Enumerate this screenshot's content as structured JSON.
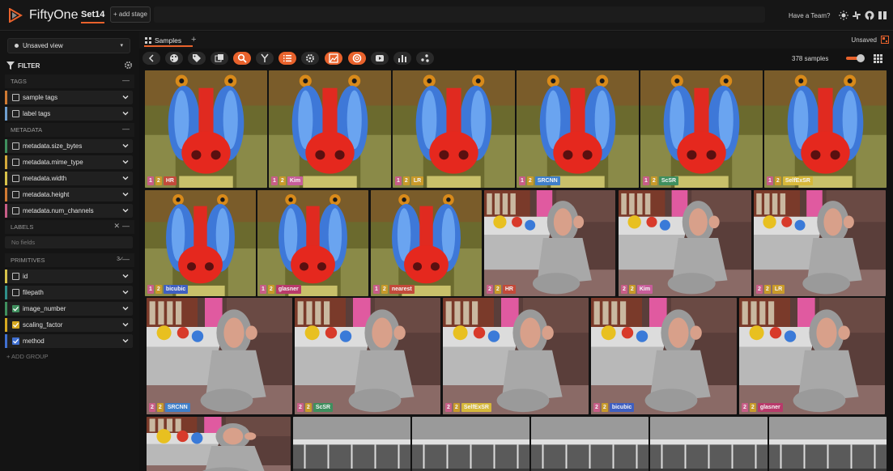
{
  "app": {
    "brand": "FiftyOne",
    "dataset": "Set14",
    "add_stage": "+ add stage",
    "team": "Have a Team?",
    "accent": "#e8622c"
  },
  "sidebar": {
    "view": "Unsaved view",
    "filter_label": "FILTER",
    "sections": {
      "tags": "TAGS",
      "metadata": "METADATA",
      "labels": "LABELS",
      "primitives": "PRIMITIVES",
      "primitives_count": "3"
    },
    "tag_fields": [
      "sample tags",
      "label tags"
    ],
    "metadata_fields": [
      "metadata.size_bytes",
      "metadata.mime_type",
      "metadata.width",
      "metadata.height",
      "metadata.num_channels"
    ],
    "labels_empty": "No fields",
    "primitive_fields": [
      "id",
      "filepath",
      "image_number",
      "scaling_factor",
      "method"
    ],
    "add_group": "+ ADD GROUP",
    "field_colors": [
      "#d07a32",
      "#6e9fd0",
      "#3f8f5e",
      "#d3a83a",
      "#d6c24a",
      "#d07a32",
      "#c75d87",
      "#d6c24a",
      "#2f8f8a",
      "#3f8f5e",
      "#d6a820",
      "#3f6fd0"
    ]
  },
  "tabs": {
    "samples": "Samples",
    "add": "+",
    "unsaved": "Unsaved"
  },
  "toolbar": {
    "count": "378 samples",
    "icons": [
      "chevron-left-icon",
      "palette-icon",
      "tag-icon",
      "clone-icon",
      "search-icon",
      "merge-icon",
      "list-icon",
      "gear-icon",
      "image-icon",
      "openai-icon",
      "video-icon",
      "chart-icon",
      "cluster-icon"
    ]
  },
  "grid": {
    "row1": [
      {
        "n": "1",
        "s": "2",
        "method": "HR"
      },
      {
        "n": "1",
        "s": "2",
        "method": "Kim"
      },
      {
        "n": "1",
        "s": "2",
        "method": "LR"
      },
      {
        "n": "1",
        "s": "2",
        "method": "SRCNN"
      },
      {
        "n": "1",
        "s": "2",
        "method": "ScSR"
      },
      {
        "n": "1",
        "s": "2",
        "method": "SelfExSR"
      }
    ],
    "row2": [
      {
        "n": "1",
        "s": "2",
        "method": "bicubic"
      },
      {
        "n": "1",
        "s": "2",
        "method": "glasner"
      },
      {
        "n": "1",
        "s": "2",
        "method": "nearest"
      },
      {
        "n": "2",
        "s": "2",
        "method": "HR"
      },
      {
        "n": "2",
        "s": "2",
        "method": "Kim"
      },
      {
        "n": "2",
        "s": "2",
        "method": "LR"
      }
    ],
    "row3": [
      {
        "n": "2",
        "s": "2",
        "method": "SRCNN"
      },
      {
        "n": "2",
        "s": "2",
        "method": "ScSR"
      },
      {
        "n": "2",
        "s": "2",
        "method": "SelfExSR"
      },
      {
        "n": "2",
        "s": "2",
        "method": "bicubic"
      },
      {
        "n": "2",
        "s": "2",
        "method": "glasner"
      }
    ],
    "method_colors": {
      "HR": "#c24a3a",
      "Kim": "#c75d9a",
      "LR": "#c99a2a",
      "SRCNN": "#3f7fc9",
      "ScSR": "#3f8f5e",
      "SelfExSR": "#d6b83a",
      "bicubic": "#3f5fc0",
      "glasner": "#b83a6a",
      "nearest": "#c24a3a"
    },
    "n_color": "#c75d87",
    "s_color": "#c79a2a"
  }
}
